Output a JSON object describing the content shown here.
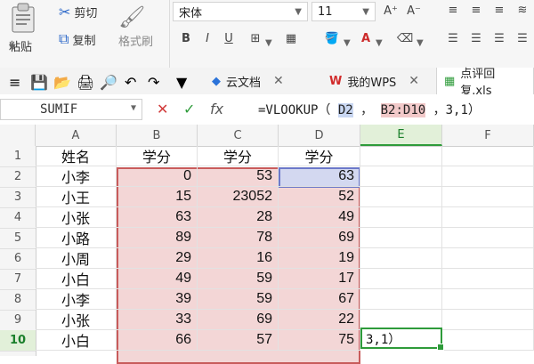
{
  "ribbon": {
    "paste_label": "粘贴",
    "cut_label": "剪切",
    "copy_label": "复制",
    "format_painter_label": "格式刷",
    "font_name": "宋体",
    "font_size": "11"
  },
  "tabs": {
    "items": [
      {
        "label": "云文档",
        "has_close": true
      },
      {
        "label": "我的WPS",
        "has_close": true
      },
      {
        "label": "点评回复.xls",
        "has_close": false
      }
    ]
  },
  "formula_bar": {
    "name_box": "SUMIF",
    "fx": "fx",
    "formula_prefix": "=VLOOKUP（",
    "arg1": "D2",
    "sep1": "，",
    "arg2": "B2:D10",
    "rest": "，3,1）"
  },
  "grid": {
    "columns": [
      "A",
      "B",
      "C",
      "D",
      "E",
      "F"
    ],
    "rows": [
      "1",
      "2",
      "3",
      "4",
      "5",
      "6",
      "7",
      "8",
      "9",
      "10"
    ],
    "headers": [
      "姓名",
      "学分",
      "学分",
      "学分"
    ],
    "names": [
      "小李",
      "小王",
      "小张",
      "小路",
      "小周",
      "小白",
      "小李",
      "小张",
      "小白"
    ],
    "B": [
      "0",
      "15",
      "63",
      "89",
      "29",
      "49",
      "39",
      "33",
      "66"
    ],
    "C": [
      "53",
      "23052",
      "28",
      "78",
      "16",
      "59",
      "59",
      "69",
      "57"
    ],
    "D": [
      "63",
      "52",
      "49",
      "69",
      "19",
      "17",
      "67",
      "22",
      "75"
    ],
    "active_cell_text": "3,1）",
    "active_col": "E",
    "active_row": "10"
  },
  "colors": {
    "range_fill": "#f3d6d6",
    "range_border": "#c85b5b",
    "ref_fill": "#d3d8f0",
    "active_green": "#2e9b3a",
    "fx_green": "#2e9b3a",
    "cancel_red": "#d13b3b"
  }
}
